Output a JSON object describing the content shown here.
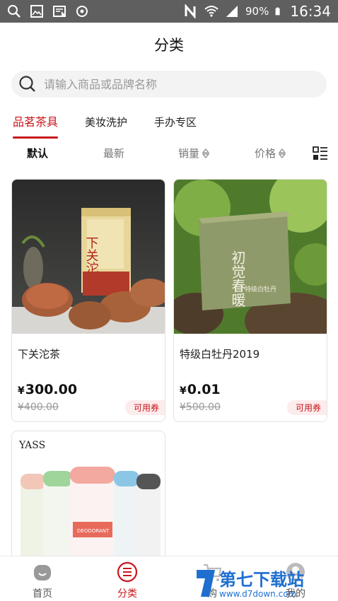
{
  "status_bar": {
    "battery": "90%",
    "time": "16:34",
    "colors": {
      "bg": "#5f5f5f",
      "fg": "#ffffff"
    },
    "left_icons": [
      "search-icon",
      "image-icon",
      "news-icon",
      "target-icon"
    ],
    "right_icons": [
      "nfc-icon",
      "wifi-icon",
      "signal-icon",
      "battery-icon"
    ]
  },
  "header": {
    "title": "分类"
  },
  "search": {
    "placeholder": "请输入商品或品牌名称"
  },
  "categories": [
    {
      "label": "品茗茶具",
      "active": true
    },
    {
      "label": "美妆洗护",
      "active": false
    },
    {
      "label": "手办专区",
      "active": false
    }
  ],
  "sort": {
    "default": "默认",
    "newest": "最新",
    "sales": "销量",
    "price": "价格"
  },
  "products": [
    {
      "name": "下关沱茶",
      "price": "300.00",
      "original_price": "¥400.00",
      "coupon": "可用券",
      "image_caption": "下关沱茶"
    },
    {
      "name": "特级白牡丹2019",
      "price": "0.01",
      "original_price": "¥500.00",
      "coupon": "可用券",
      "image_caption": "初觉春暖",
      "image_subcaption": "特级白牡丹"
    },
    {
      "name": "",
      "image_brand": "YASS",
      "image_label": "DEODORANT"
    }
  ],
  "currency": "¥",
  "bottom_nav": [
    {
      "label": "首页",
      "icon": "home-icon",
      "active": false
    },
    {
      "label": "分类",
      "icon": "category-icon",
      "active": true
    },
    {
      "label": "购",
      "icon": "cart-icon",
      "active": false
    },
    {
      "label": "我的",
      "icon": "profile-icon",
      "active": false
    }
  ],
  "watermark": {
    "title": "第七下载站",
    "url": "www.d7down.com"
  },
  "accent_color": "#c8161d"
}
